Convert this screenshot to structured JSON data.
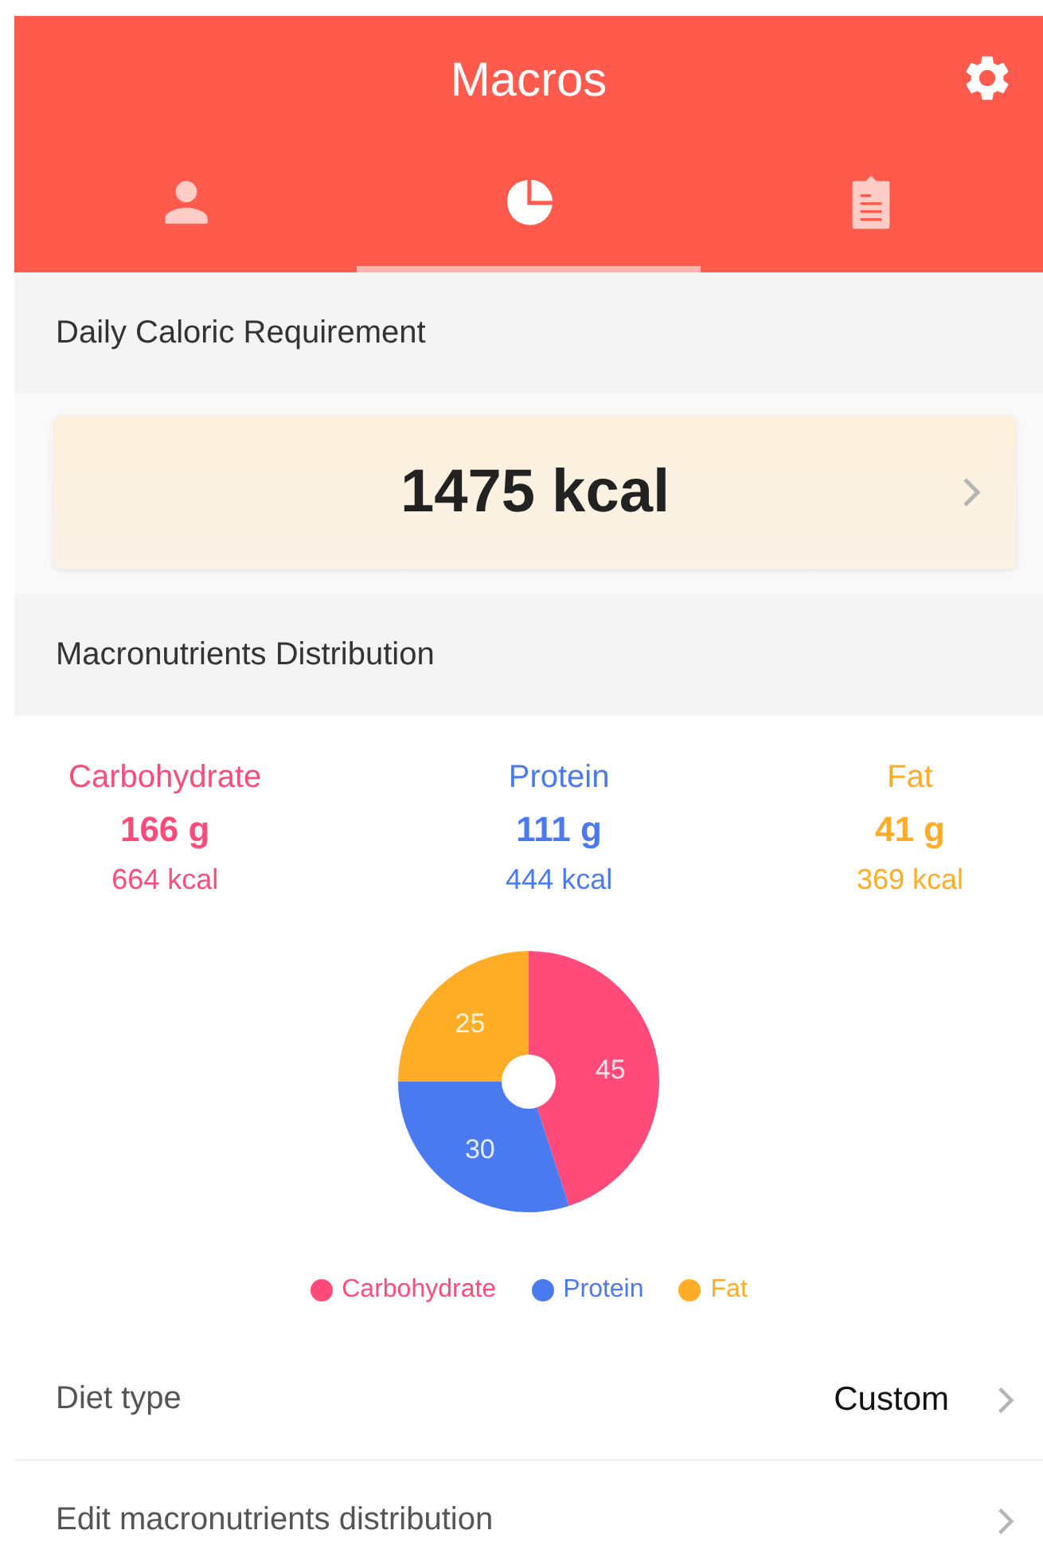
{
  "header": {
    "title": "Macros"
  },
  "tabs": [
    {
      "kind": "person",
      "selected": false
    },
    {
      "kind": "pie",
      "selected": true
    },
    {
      "kind": "clipboard",
      "selected": false
    }
  ],
  "calories": {
    "heading": "Daily Caloric Requirement",
    "value": "1475 kcal"
  },
  "distribution": {
    "heading": "Macronutrients Distribution",
    "macros": [
      {
        "name": "Carbohydrate",
        "grams": "166 g",
        "kcal": "664 kcal",
        "color": "#ff4a7a"
      },
      {
        "name": "Protein",
        "grams": "111 g",
        "kcal": "444 kcal",
        "color": "#4a7aef"
      },
      {
        "name": "Fat",
        "grams": "41 g",
        "kcal": "369 kcal",
        "color": "#ffad27"
      }
    ],
    "chart_data": {
      "type": "donut",
      "categories": [
        "Carbohydrate",
        "Protein",
        "Fat"
      ],
      "values": [
        45,
        30,
        25
      ],
      "data_labels": true,
      "colors": [
        "#ff4a7a",
        "#4a7aef",
        "#ffad27"
      ]
    }
  },
  "settings": [
    {
      "label": "Diet type",
      "value": "Custom"
    },
    {
      "label": "Edit macronutrients distribution"
    }
  ]
}
